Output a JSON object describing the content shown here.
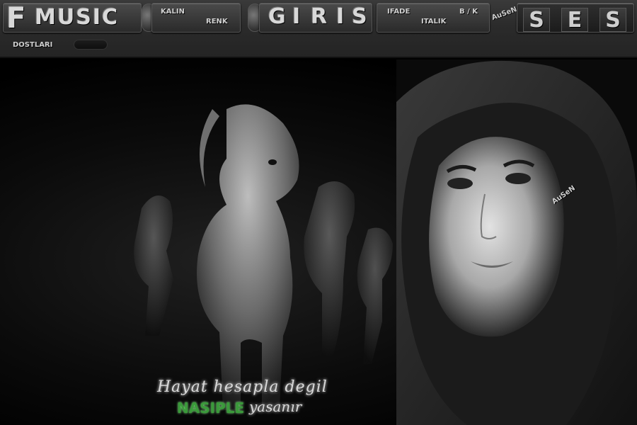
{
  "toolbar": {
    "music_prefix": "F",
    "music_label": "MUSIC",
    "kalin_label": "KALIN",
    "renk_label": "RENK",
    "giris_letters": [
      "G",
      "I",
      "R",
      "I",
      "S"
    ],
    "ifade_label": "IFADE",
    "italik_label": "ITALIK",
    "bk_label": "B / K",
    "watermark_top": "AuSeN",
    "ses_letters": [
      "S",
      "E",
      "S"
    ],
    "dostlari_label": "DOSTLARI"
  },
  "scene": {
    "quote_line1": "Hayat hesapla degil",
    "quote_highlight": "NASIPLE",
    "quote_line2_rest": "yasanır",
    "watermark_face": "AuSeN"
  }
}
